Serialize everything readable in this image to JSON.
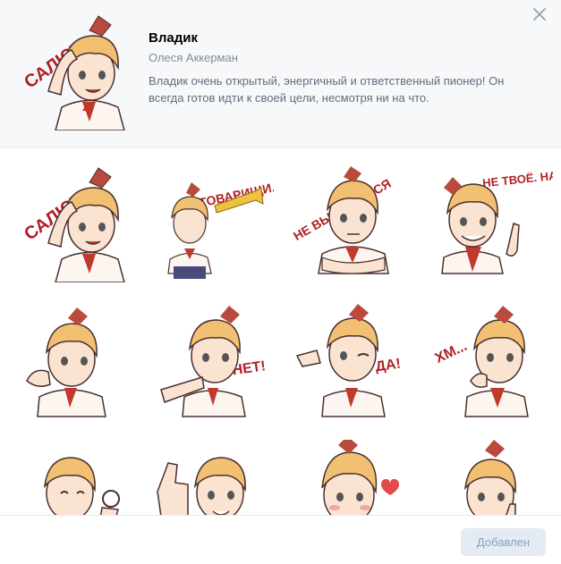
{
  "pack": {
    "title": "Владик",
    "author": "Олеся Аккерман",
    "description": "Владик очень открытый, энергичный и ответственный пионер! Он всегда готов идти к своей цели, несмотря ни на что."
  },
  "header_sticker": {
    "caption": "САЛЮТ!",
    "icon": "salute-sticker"
  },
  "stickers": [
    {
      "caption": "САЛЮТ!",
      "pose": "salute"
    },
    {
      "caption": "ТОВАРИЩИ, ОБЩИЙ СБОР!",
      "pose": "trumpet"
    },
    {
      "caption": "НЕ ВЫРА-ЖАЙСЯ",
      "pose": "arms-crossed"
    },
    {
      "caption": "НЕ ТВОЁ. НАШЕ!",
      "pose": "grin"
    },
    {
      "caption": "",
      "pose": "shy"
    },
    {
      "caption": "НЕТ!",
      "pose": "refuse"
    },
    {
      "caption": "ДА!",
      "pose": "wink-point"
    },
    {
      "caption": "ХМ...",
      "pose": "thinking"
    },
    {
      "caption": "",
      "pose": "ok-gesture"
    },
    {
      "caption": "",
      "pose": "thumbs-up"
    },
    {
      "caption": "",
      "pose": "blush-heart"
    },
    {
      "caption": "",
      "pose": "shush"
    }
  ],
  "footer": {
    "button_label": "Добавлен"
  },
  "colors": {
    "hair": "#f2c073",
    "bow": "#b94a3c",
    "tie": "#c0392b",
    "skin": "#fbe3d2",
    "shirt": "#fdf6f0",
    "caption": "#b21f24"
  }
}
